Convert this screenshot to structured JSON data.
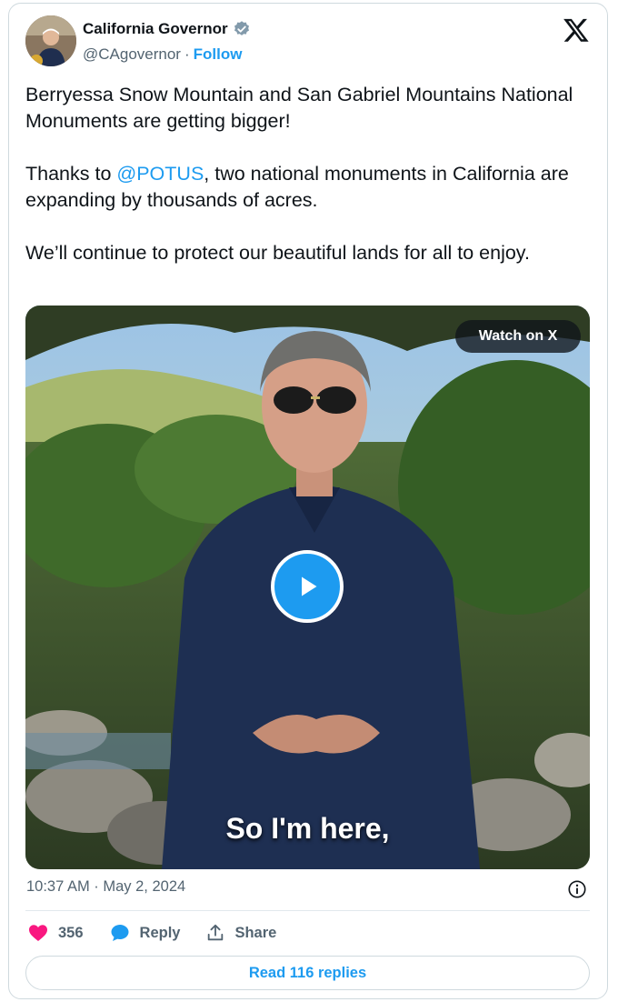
{
  "author": {
    "display_name": "California Governor",
    "handle": "@CAgovernor",
    "separator": "·",
    "follow_label": "Follow",
    "verified_icon": "verified-badge-icon",
    "avatar_icon": "profile-photo"
  },
  "platform": {
    "logo_icon": "x-logo-icon"
  },
  "tweet": {
    "paragraph1": "Berryessa Snow Mountain and San Gabriel Mountains National Monuments are getting bigger!",
    "paragraph2_prefix": "Thanks to ",
    "paragraph2_mention": "@POTUS",
    "paragraph2_suffix": ", two national monuments in California are expanding by thousands of acres.",
    "paragraph3": "We’ll continue to protect our beautiful lands for all to enjoy."
  },
  "media": {
    "watch_label": "Watch on X",
    "caption": "So I'm here,",
    "play_icon": "play-icon"
  },
  "meta": {
    "timestamp": "10:37 AM · May 2, 2024",
    "info_icon": "info-icon"
  },
  "actions": {
    "like_count": "356",
    "reply_label": "Reply",
    "share_label": "Share",
    "read_replies_label": "Read 116 replies"
  },
  "colors": {
    "accent": "#1d9bf0",
    "like": "#f91880",
    "text": "#0f1419",
    "secondary": "#536471"
  }
}
